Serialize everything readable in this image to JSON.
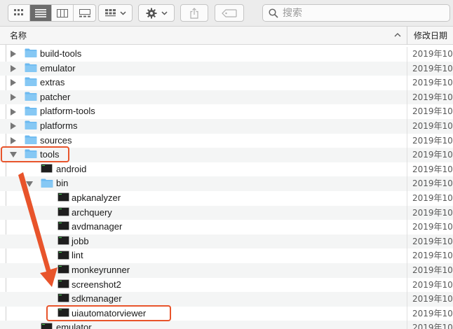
{
  "toolbar": {
    "view_buttons": [
      {
        "name": "icon-view-button",
        "icon": "grid-icon"
      },
      {
        "name": "list-view-button",
        "icon": "list-icon"
      },
      {
        "name": "column-view-button",
        "icon": "columns-icon"
      },
      {
        "name": "gallery-view-button",
        "icon": "gallery-icon"
      }
    ],
    "group_icon": "group-icon",
    "action_icon": "gear-icon",
    "share_icon": "share-icon",
    "tag_icon": "tag-icon"
  },
  "search": {
    "placeholder": "搜索"
  },
  "header": {
    "name_col": "名称",
    "date_col": "修改日期"
  },
  "colors": {
    "folder": "#6bb9f0",
    "highlight": "#e8542b",
    "exec": "#1e1e1e"
  },
  "rows": [
    {
      "label": "build-tools",
      "date": "2019年10",
      "type": "folder",
      "level": 0,
      "disclosure": "collapsed"
    },
    {
      "label": "emulator",
      "date": "2019年10",
      "type": "folder",
      "level": 0,
      "disclosure": "collapsed"
    },
    {
      "label": "extras",
      "date": "2019年10",
      "type": "folder",
      "level": 0,
      "disclosure": "collapsed"
    },
    {
      "label": "patcher",
      "date": "2019年10",
      "type": "folder",
      "level": 0,
      "disclosure": "collapsed"
    },
    {
      "label": "platform-tools",
      "date": "2019年10",
      "type": "folder",
      "level": 0,
      "disclosure": "collapsed"
    },
    {
      "label": "platforms",
      "date": "2019年10",
      "type": "folder",
      "level": 0,
      "disclosure": "collapsed"
    },
    {
      "label": "sources",
      "date": "2019年10",
      "type": "folder",
      "level": 0,
      "disclosure": "collapsed"
    },
    {
      "label": "tools",
      "date": "2019年10",
      "type": "folder",
      "level": 0,
      "disclosure": "expanded"
    },
    {
      "label": "android",
      "date": "2019年10",
      "type": "exec",
      "level": 1,
      "disclosure": "none"
    },
    {
      "label": "bin",
      "date": "2019年10",
      "type": "folder",
      "level": 1,
      "disclosure": "expanded"
    },
    {
      "label": "apkanalyzer",
      "date": "2019年10",
      "type": "exec",
      "level": 2,
      "disclosure": "none"
    },
    {
      "label": "archquery",
      "date": "2019年10",
      "type": "exec",
      "level": 2,
      "disclosure": "none"
    },
    {
      "label": "avdmanager",
      "date": "2019年10",
      "type": "exec",
      "level": 2,
      "disclosure": "none"
    },
    {
      "label": "jobb",
      "date": "2019年10",
      "type": "exec",
      "level": 2,
      "disclosure": "none"
    },
    {
      "label": "lint",
      "date": "2019年10",
      "type": "exec",
      "level": 2,
      "disclosure": "none"
    },
    {
      "label": "monkeyrunner",
      "date": "2019年10",
      "type": "exec",
      "level": 2,
      "disclosure": "none"
    },
    {
      "label": "screenshot2",
      "date": "2019年10",
      "type": "exec",
      "level": 2,
      "disclosure": "none"
    },
    {
      "label": "sdkmanager",
      "date": "2019年10",
      "type": "exec",
      "level": 2,
      "disclosure": "none"
    },
    {
      "label": "uiautomatorviewer",
      "date": "2019年10",
      "type": "exec",
      "level": 2,
      "disclosure": "none"
    },
    {
      "label": "emulator",
      "date": "2019年10",
      "type": "exec",
      "level": 1,
      "disclosure": "none"
    }
  ]
}
